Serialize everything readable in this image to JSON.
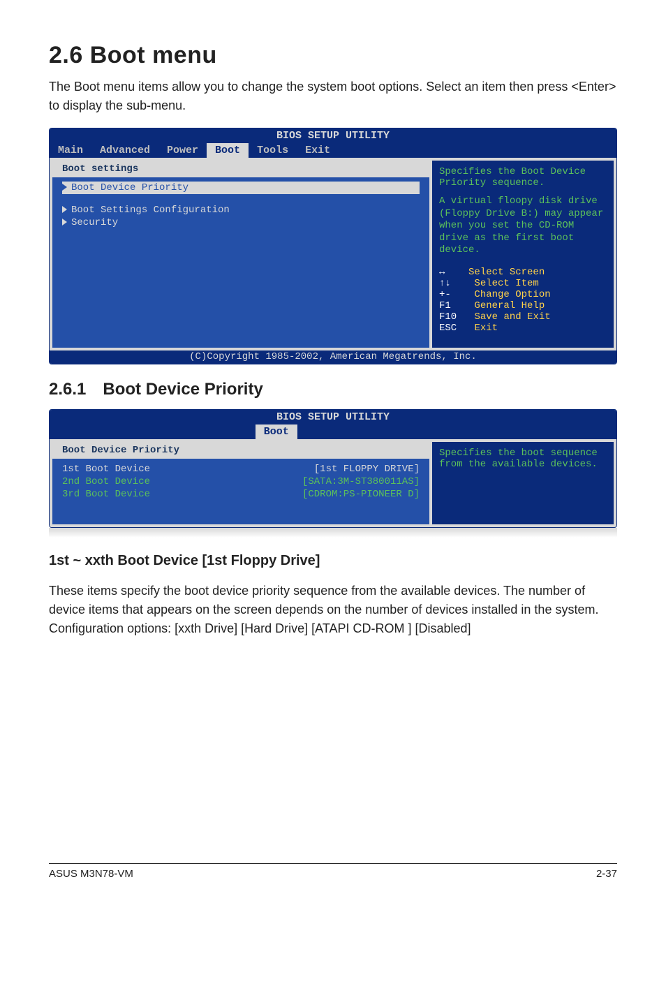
{
  "section": {
    "number": "2.6",
    "title": "Boot menu",
    "intro": "The Boot menu items allow you to change the system boot options. Select an item then press <Enter> to display the sub-menu."
  },
  "bios1": {
    "utility_title": "BIOS SETUP UTILITY",
    "tabs": [
      "Main",
      "Advanced",
      "Power",
      "Boot",
      "Tools",
      "Exit"
    ],
    "active_tab": "Boot",
    "heading": "Boot settings",
    "items": [
      {
        "label": "Boot Device Priority",
        "selected": true
      },
      {
        "label": "Boot Settings Configuration",
        "selected": false
      },
      {
        "label": "Security",
        "selected": false
      }
    ],
    "help_top": "Specifies the Boot Device Priority sequence.",
    "help_mid": "A virtual floopy disk drive (Floppy Drive B:) may appear when you set the CD-ROM drive as the first boot device.",
    "legend": [
      {
        "key": "↔",
        "txt": "Select Screen"
      },
      {
        "key": "↑↓",
        "txt": "Select Item"
      },
      {
        "key": "+-",
        "txt": "Change Option"
      },
      {
        "key": "F1",
        "txt": "General Help"
      },
      {
        "key": "F10",
        "txt": "Save and Exit"
      },
      {
        "key": "ESC",
        "txt": "Exit"
      }
    ],
    "footer": "(C)Copyright 1985-2002, American Megatrends, Inc."
  },
  "subsection": {
    "number": "2.6.1",
    "title": "Boot Device Priority"
  },
  "bios2": {
    "utility_title": "BIOS SETUP UTILITY",
    "active_tab": "Boot",
    "heading": "Boot Device Priority",
    "rows": [
      {
        "label": "1st Boot Device",
        "value": "[1st FLOPPY DRIVE]",
        "selected": true
      },
      {
        "label": "2nd Boot Device",
        "value": "[SATA:3M-ST380011AS]",
        "selected": false
      },
      {
        "label": "3rd Boot Device",
        "value": "[CDROM:PS-PIONEER D]",
        "selected": false
      }
    ],
    "help": "Specifies the boot sequence from the available devices."
  },
  "subsub": {
    "title": "1st ~ xxth Boot Device [1st Floppy Drive]",
    "para": "These items specify the boot device priority sequence from the available devices. The number of device items that appears on the screen depends on the number of devices installed in the system. Configuration options: [xxth Drive] [Hard Drive] [ATAPI CD-ROM ] [Disabled]"
  },
  "footer": {
    "left": "ASUS M3N78-VM",
    "right": "2-37"
  }
}
